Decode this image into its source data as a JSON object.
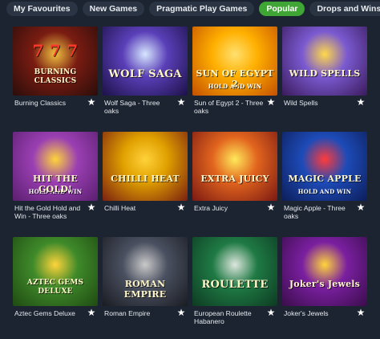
{
  "tabs": [
    {
      "label": "My Favourites"
    },
    {
      "label": "New Games"
    },
    {
      "label": "Pragmatic Play Games"
    },
    {
      "label": "Popular"
    },
    {
      "label": "Drops and Wins"
    }
  ],
  "active_tab": "Popular",
  "games": [
    {
      "title": "Burning Classics",
      "logo": "BURNING CLASSICS",
      "glyph": "7 7 7",
      "colors": [
        "#2a0d0a",
        "#7a1c12",
        "#f0c040"
      ]
    },
    {
      "title": "Wolf Saga - Three oaks",
      "logo": "WOLF SAGA",
      "glyph": "",
      "colors": [
        "#1c1147",
        "#5a3fb8",
        "#d6e6ff"
      ]
    },
    {
      "title": "Sun of Egypt 2 - Three oaks",
      "logo": "SUN OF EGYPT 2",
      "glyph": "HOLD AND WIN",
      "colors": [
        "#c44f00",
        "#ffb000",
        "#ffe070"
      ]
    },
    {
      "title": "Wild Spells",
      "logo": "WILD SPELLS",
      "glyph": "",
      "colors": [
        "#3a1a5a",
        "#7a5ad0",
        "#ffd84a"
      ]
    },
    {
      "title": "Hit the Gold Hold and Win - Three oaks",
      "logo": "HIT THE GOLD!",
      "glyph": "HOLD AND WIN",
      "colors": [
        "#5a1f6f",
        "#9b3fb3",
        "#ffd43a"
      ]
    },
    {
      "title": "Chilli Heat",
      "logo": "CHILLI HEAT",
      "glyph": "",
      "colors": [
        "#7a1f10",
        "#e0a000",
        "#ffd23a"
      ]
    },
    {
      "title": "Extra Juicy",
      "logo": "EXTRA JUICY",
      "glyph": "",
      "colors": [
        "#7a1812",
        "#e2651e",
        "#ffe85a"
      ]
    },
    {
      "title": "Magic Apple - Three oaks",
      "logo": "MAGIC APPLE",
      "glyph": "HOLD AND WIN",
      "colors": [
        "#0d1e5a",
        "#1d4bb8",
        "#ff3b3b"
      ]
    },
    {
      "title": "Aztec Gems Deluxe",
      "logo": "AZTEC GEMS DELUXE",
      "glyph": "",
      "colors": [
        "#1f4a12",
        "#3f8a2a",
        "#ffd43a"
      ]
    },
    {
      "title": "Roman Empire",
      "logo": "ROMAN EMPIRE",
      "glyph": "",
      "colors": [
        "#1a1c22",
        "#4a5060",
        "#c9c9c9"
      ]
    },
    {
      "title": "European Roulette Habanero",
      "logo": "ROULETTE",
      "glyph": "",
      "colors": [
        "#0d3a22",
        "#1f7a44",
        "#dde6dd"
      ]
    },
    {
      "title": "Joker's Jewels",
      "logo": "Joker's Jewels",
      "glyph": "",
      "colors": [
        "#3a0d4a",
        "#7a1fa0",
        "#ffd43a"
      ]
    }
  ]
}
